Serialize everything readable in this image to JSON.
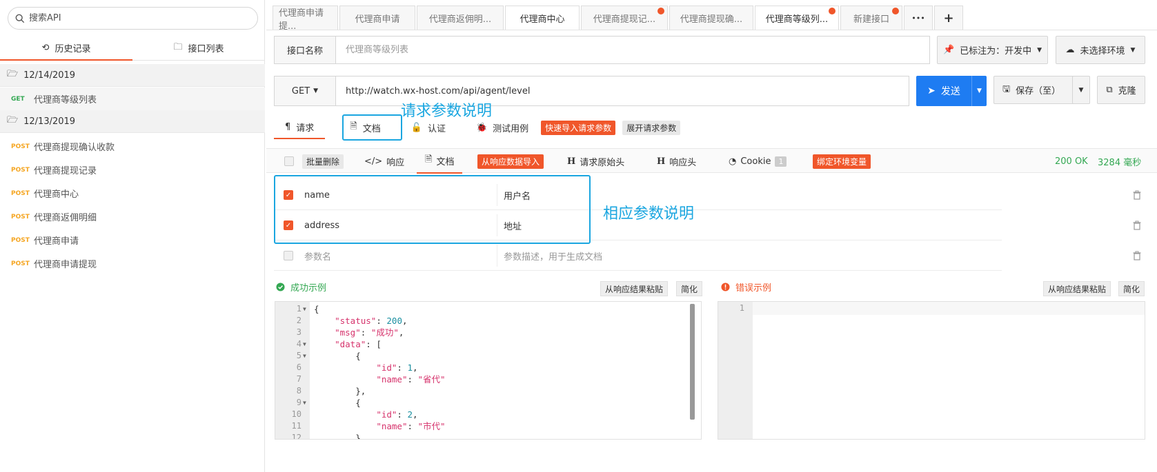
{
  "sidebar": {
    "search_placeholder": "搜索API",
    "tabs": [
      {
        "label": "历史记录",
        "icon": "history-icon"
      },
      {
        "label": "接口列表",
        "icon": "folder-icon"
      }
    ],
    "groups": [
      {
        "date": "12/14/2019",
        "items": [
          {
            "method": "GET",
            "name": "代理商等级列表"
          }
        ]
      },
      {
        "date": "12/13/2019",
        "items": [
          {
            "method": "POST",
            "name": "代理商提现确认收款"
          },
          {
            "method": "POST",
            "name": "代理商提现记录"
          },
          {
            "method": "POST",
            "name": "代理商中心"
          },
          {
            "method": "POST",
            "name": "代理商返佣明细"
          },
          {
            "method": "POST",
            "name": "代理商申请"
          },
          {
            "method": "POST",
            "name": "代理商申请提现"
          }
        ]
      }
    ]
  },
  "tabs": [
    {
      "label": "代理商申请提...",
      "dot": false
    },
    {
      "label": "代理商申请",
      "dot": false
    },
    {
      "label": "代理商返佣明...",
      "dot": false
    },
    {
      "label": "代理商中心",
      "dot": false
    },
    {
      "label": "代理商提现记...",
      "dot": true
    },
    {
      "label": "代理商提现确...",
      "dot": false
    },
    {
      "label": "代理商等级列...",
      "dot": true
    },
    {
      "label": "新建接口",
      "dot": true
    }
  ],
  "tab_more": "•••",
  "tab_add": "+",
  "request": {
    "name_label": "接口名称",
    "name_placeholder": "代理商等级列表",
    "status_label": "已标注为：开发中",
    "env_label": "未选择环境",
    "method": "GET",
    "url": "http://watch.wx-host.com/api/agent/level",
    "send_label": "发送",
    "save_label": "保存（至）",
    "clone_label": "克隆",
    "tabs": [
      {
        "label": "请求"
      },
      {
        "label": "文档"
      },
      {
        "label": "认证"
      },
      {
        "label": "测试用例"
      }
    ],
    "quick_import": "快速导入请求参数",
    "expand_params": "展开请求参数"
  },
  "annotations": {
    "request_doc": "请求参数说明",
    "response_doc": "相应参数说明"
  },
  "response": {
    "batch_delete": "批量删除",
    "tabs": {
      "response": "响应",
      "doc": "文档",
      "import_from_response": "从响应数据导入",
      "raw_request_headers": "请求原始头",
      "response_headers": "响应头",
      "cookie": "Cookie",
      "cookie_count": "1",
      "bind_env": "绑定环境变量"
    },
    "status": "200 OK",
    "time": "3284 毫秒",
    "params": [
      {
        "name": "name",
        "desc": "用户名",
        "checked": true
      },
      {
        "name": "address",
        "desc": "地址",
        "checked": true
      }
    ],
    "new_param_placeholder": "参数名",
    "new_desc_placeholder": "参数描述，用于生成文档"
  },
  "success_example": {
    "title": "成功示例",
    "paste_btn": "从响应结果粘贴",
    "simplify_btn": "简化"
  },
  "error_example": {
    "title": "错误示例",
    "paste_btn": "从响应结果粘贴",
    "simplify_btn": "简化"
  },
  "code_lines": [
    "{",
    "    \"status\": 200,",
    "    \"msg\": \"成功\",",
    "    \"data\": [",
    "        {",
    "            \"id\": 1,",
    "            \"name\": \"省代\"",
    "        },",
    "        {",
    "            \"id\": 2,",
    "            \"name\": \"市代\"",
    "        }"
  ],
  "colors": {
    "accent": "#f0562a",
    "primary": "#1e7cf2",
    "annotation": "#1aa6e0",
    "success": "#34a853"
  }
}
